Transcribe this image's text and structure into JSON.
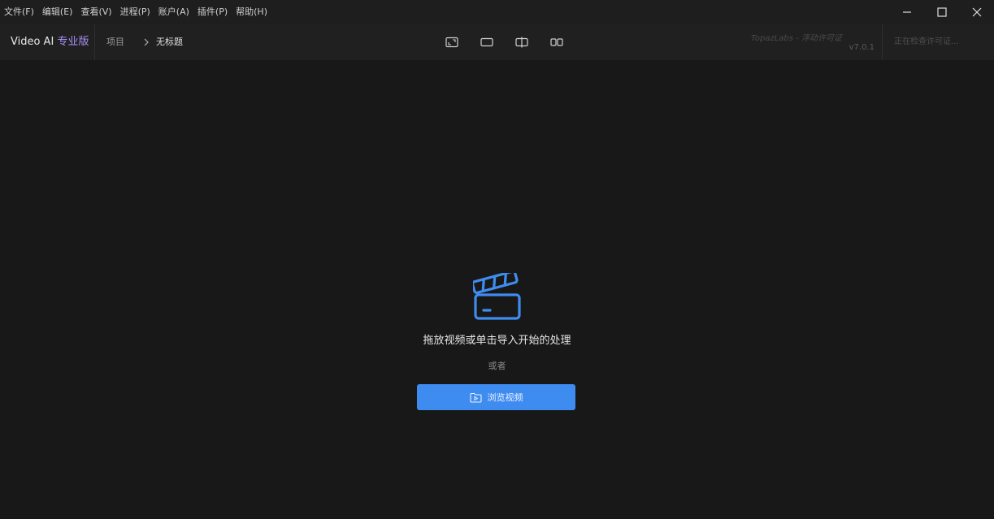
{
  "menu": [
    {
      "id": "file",
      "label": "文件(F)"
    },
    {
      "id": "edit",
      "label": "编辑(E)"
    },
    {
      "id": "view",
      "label": "查看(V)"
    },
    {
      "id": "process",
      "label": "进程(P)"
    },
    {
      "id": "account",
      "label": "账户(A)"
    },
    {
      "id": "plugins",
      "label": "插件(P)"
    },
    {
      "id": "help",
      "label": "帮助(H)"
    }
  ],
  "window_controls": {
    "minimize": "minimize-icon",
    "maximize": "maximize-icon",
    "close": "close-icon"
  },
  "brand": {
    "name": "Video AI",
    "edition": "专业版",
    "edition_color": "#a98ff7"
  },
  "breadcrumb": {
    "project": "项目",
    "current": "无标题"
  },
  "view_modes": [
    {
      "id": "single",
      "icon": "single-view-icon"
    },
    {
      "id": "preview",
      "icon": "preview-view-icon"
    },
    {
      "id": "split",
      "icon": "split-view-icon"
    },
    {
      "id": "side-by-side",
      "icon": "side-by-side-view-icon"
    }
  ],
  "watermark": "TopazLabs - 浮动许可证",
  "version": "v7.0.1",
  "license_status": "正在检查许可证...",
  "dropzone": {
    "icon": "clapperboard-icon",
    "hint": "拖放视频或单击导入开始的处理",
    "or": "或者",
    "browse_label": "浏览视频",
    "browse_icon": "folder-video-icon",
    "accent_color": "#3f8cf0"
  }
}
